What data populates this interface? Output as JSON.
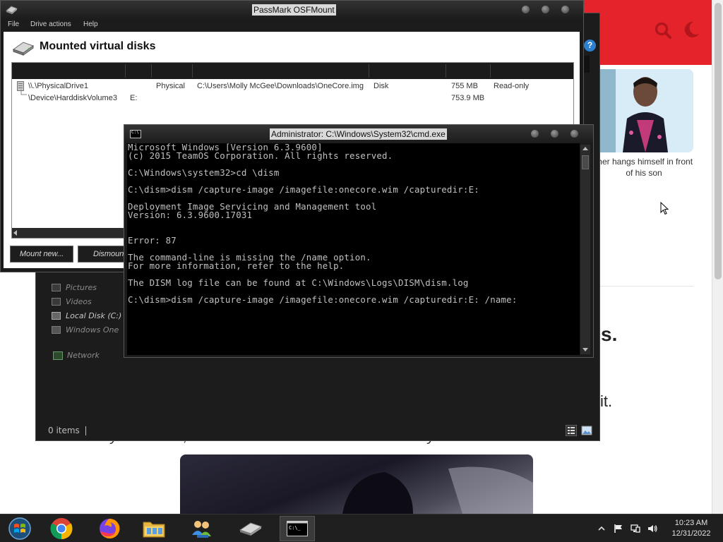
{
  "webpage": {
    "caption": "ther hangs himself in front of his son",
    "heading_fragment": "s.",
    "text_fragment": "it.",
    "italic_line": "If you are lost, here is an anime that we recommend you to watch instead"
  },
  "explorer": {
    "nav_items": [
      {
        "label": "Pictures",
        "icon": "pictures-icon"
      },
      {
        "label": "Videos",
        "icon": "videos-icon"
      },
      {
        "label": "Local Disk (C:)",
        "icon": "drive-icon"
      },
      {
        "label": "Windows One",
        "icon": "drive-icon"
      }
    ],
    "network_label": "Network",
    "status": "0 items"
  },
  "osfmount": {
    "title": "PassMark OSFMount",
    "menu": [
      "File",
      "Drive actions",
      "Help"
    ],
    "heading": "Mounted virtual disks",
    "rows": [
      {
        "drive": "\\\\.\\PhysicalDrive1",
        "letter": "",
        "type": "Physical",
        "source": "C:\\Users\\Molly McGee\\Downloads\\OneCore.img",
        "target": "Disk",
        "size": "755 MB",
        "properties": "Read-only"
      },
      {
        "drive": "\\Device\\HarddiskVolume3",
        "letter": "E:",
        "type": "",
        "source": "",
        "target": "",
        "size": "753.9 MB",
        "properties": ""
      }
    ],
    "buttons": {
      "mount_new": "Mount new...",
      "dismount": "Dismount"
    }
  },
  "cmd": {
    "title": "Administrator: C:\\Windows\\System32\\cmd.exe",
    "lines": [
      "Microsoft Windows [Version 6.3.9600]",
      "(c) 2015 TeamOS Corporation. All rights reserved.",
      "",
      "C:\\Windows\\system32>cd \\dism",
      "",
      "C:\\dism>dism /capture-image /imagefile:onecore.wim /capturedir:E:",
      "",
      "Deployment Image Servicing and Management tool",
      "Version: 6.3.9600.17031",
      "",
      "",
      "Error: 87",
      "",
      "The command-line is missing the /name option.",
      "For more information, refer to the help.",
      "",
      "The DISM log file can be found at C:\\Windows\\Logs\\DISM\\dism.log",
      "",
      "C:\\dism>dism /capture-image /imagefile:onecore.wim /capturedir:E: /name:"
    ]
  },
  "taskbar": {
    "apps": [
      {
        "name": "start-orb",
        "icon": "windows-start-icon"
      },
      {
        "name": "chrome",
        "icon": "chrome-icon"
      },
      {
        "name": "firefox",
        "icon": "firefox-icon"
      },
      {
        "name": "file-explorer",
        "icon": "folder-icon"
      },
      {
        "name": "network-users",
        "icon": "people-network-icon"
      },
      {
        "name": "osfmount",
        "icon": "drive-icon"
      },
      {
        "name": "cmd",
        "icon": "cmd-icon"
      }
    ],
    "clock_time": "10:23 AM",
    "clock_date": "12/31/2022"
  }
}
